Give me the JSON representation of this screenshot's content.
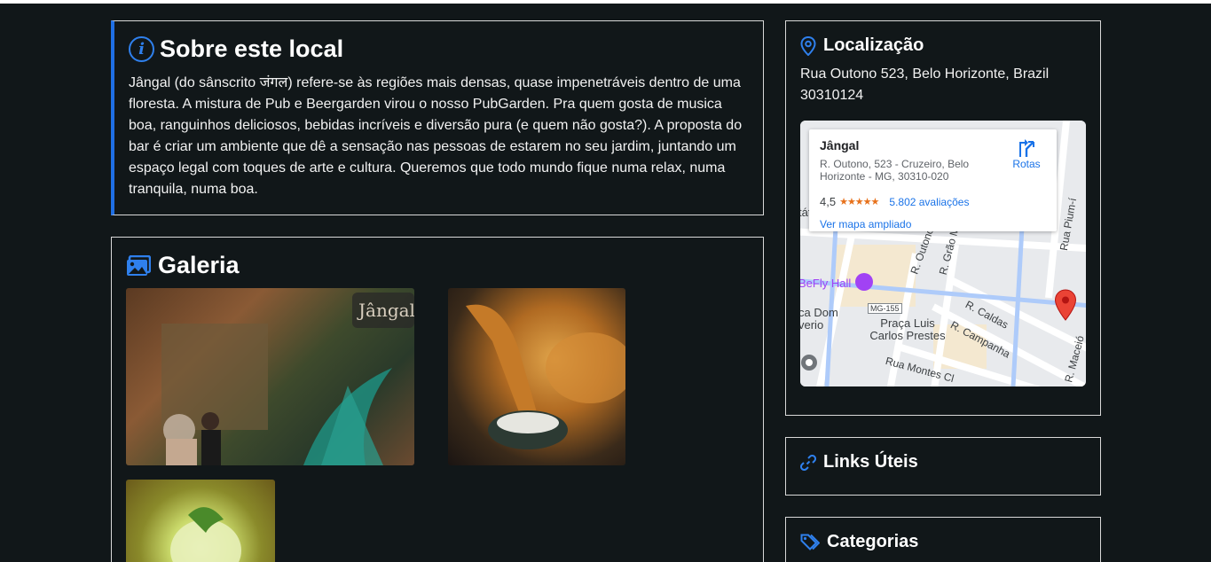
{
  "about": {
    "title": "Sobre este local",
    "text": "Jângal (do sânscrito जंगल) refere-se às regiões mais densas, quase impenetráveis dentro de uma floresta. A mistura de Pub e Beergarden virou o nosso PubGarden. Pra quem gosta de musica boa, ranguinhos deliciosos, bebidas incríveis e diversão pura (e quem não gosta?). A proposta do bar é criar um ambiente que dê a sensação nas pessoas de estarem no seu jardim, juntando um espaço legal com toques de arte e cultura. Queremos que todo mundo fique numa relax, numa tranquila, numa boa."
  },
  "gallery": {
    "title": "Galeria",
    "photos": [
      "bar-storefront-photo",
      "fried-snack-photo",
      "drink-photo"
    ]
  },
  "location": {
    "title": "Localização",
    "address": "Rua Outono 523, Belo Horizonte, Brazil 30310124",
    "map": {
      "place_name": "Jângal",
      "place_address": "R. Outono, 523 - Cruzeiro, Belo Horizonte - MG, 30310-020",
      "rating": "4,5",
      "stars": "★★★★★",
      "reviews": "5.802 avaliações",
      "bigger_map": "Ver mapa ampliado",
      "directions": "Rotas",
      "labels": {
        "befly": "BeFly Hall",
        "route": "MG-155",
        "praca": "Praça Luis Carlos Prestes",
        "dom": "ca Dom verio",
        "outono": "R. Outono",
        "grao": "R. Grão M",
        "caldas": "R. Caldas",
        "campanha": "R. Campanha",
        "montes": "Rua Montes Cl",
        "pium": "Rua Pium-í",
        "maceio": "R. Maceió",
        "tat": "tát"
      }
    }
  },
  "links": {
    "title": "Links Úteis"
  },
  "categories": {
    "title": "Categorias"
  },
  "colors": {
    "accent": "#2f80ed",
    "background": "#111719",
    "border": "#d9d9d9"
  }
}
